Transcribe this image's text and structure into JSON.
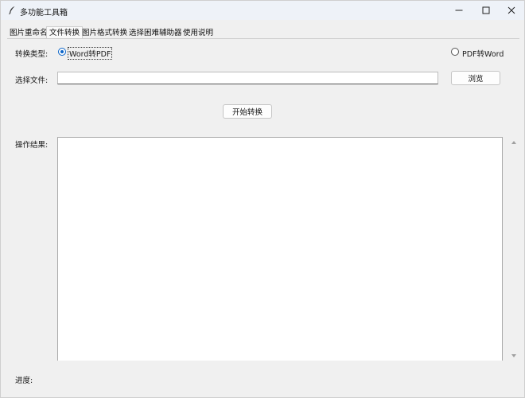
{
  "window": {
    "title": "多功能工具箱",
    "app_icon": "feather-icon",
    "controls": [
      "minimize-icon",
      "maximize-icon",
      "close-icon"
    ]
  },
  "tabs": [
    {
      "label": "图片重命名",
      "active": false
    },
    {
      "label": "文件转换",
      "active": true
    },
    {
      "label": "图片格式转换",
      "active": false
    },
    {
      "label": "选择困难辅助器",
      "active": false
    },
    {
      "label": "使用说明",
      "active": false
    }
  ],
  "conversion": {
    "type_label": "转换类型:",
    "options": [
      {
        "label": "Word转PDF",
        "selected": true
      },
      {
        "label": "PDF转Word",
        "selected": false
      }
    ]
  },
  "file_select": {
    "label": "选择文件:",
    "value": "",
    "browse_label": "浏览"
  },
  "start_button_label": "开始转换",
  "result": {
    "label": "操作结果:",
    "text": ""
  },
  "progress": {
    "label": "进度:",
    "value": 0
  },
  "colors": {
    "accent": "#0a64c8",
    "background": "#f0f0f0",
    "titlebar": "#eef2f8"
  }
}
